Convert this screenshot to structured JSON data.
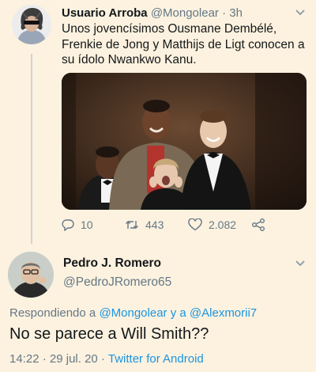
{
  "tweet1": {
    "display_name": "Usuario Arroba",
    "handle": "@Mongolear",
    "separator": "·",
    "time": "3h",
    "text": "Unos jovencísimos Ousmane Dembélé, Frenkie de Jong y Matthijs de Ligt conocen a su ídolo Nwankwo Kanu.",
    "replies": "10",
    "retweets": "443",
    "likes": "2.082"
  },
  "tweet2": {
    "display_name": "Pedro J. Romero",
    "handle": "@PedroJRomero65",
    "replying_prefix": "Respondiendo a",
    "replying_user1": "@Mongolear",
    "replying_joiner": "y a",
    "replying_user2": "@Alexmorii7",
    "text": "No se parece a Will Smith??",
    "time": "14:22",
    "separator": "·",
    "date": "29 jul. 20",
    "source_separator": "·",
    "source": "Twitter for Android"
  },
  "icons": {
    "reply": "reply-icon",
    "retweet": "retweet-icon",
    "like": "heart-icon",
    "share": "share-icon",
    "more": "chevron-down-icon"
  },
  "colors": {
    "background": "#fcf2df",
    "text": "#14171a",
    "muted": "#657786",
    "link": "#1b95e0",
    "thread_line": "#cdd3d8"
  }
}
